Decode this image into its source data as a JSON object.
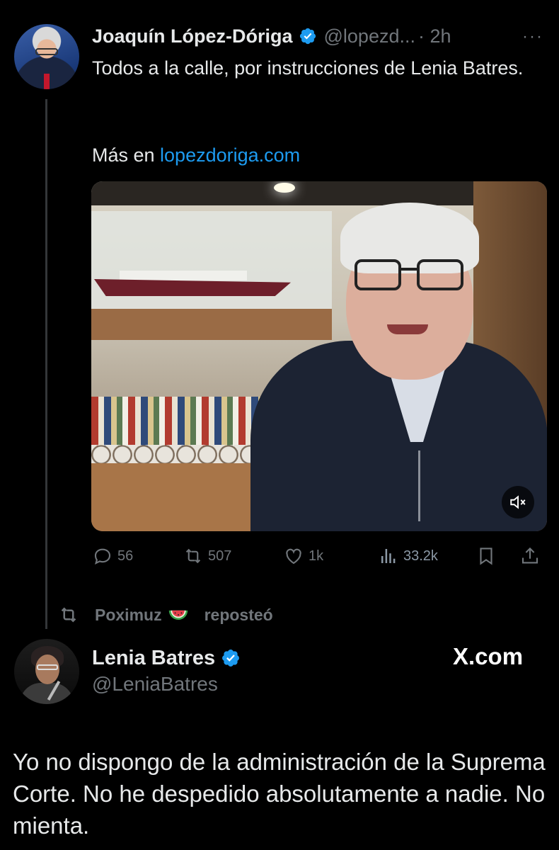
{
  "tweet1": {
    "author_name": "Joaquín López-Dóriga",
    "handle": "@lopezd...",
    "time": "· 2h",
    "more": "···",
    "text": "Todos a la calle, por instrucciones de Lenia Batres.",
    "more_text": "Más en ",
    "link_text": "lopezdoriga.com",
    "actions": {
      "replies": "56",
      "reposts": "507",
      "likes": "1k",
      "views": "33.2k"
    }
  },
  "repost": {
    "user": "Poximuz",
    "label": "reposteó"
  },
  "tweet2": {
    "author_name": "Lenia Batres",
    "handle": "@LeniaBatres",
    "brand": "X.com",
    "text": "Yo no dispongo de la administración de la Suprema Corte. No he despedido absolutamente a nadie. No mienta."
  },
  "colors": {
    "background": "#000000",
    "text": "#e7e9ea",
    "secondary": "#71767b",
    "link": "#1d9bf0",
    "verified": "#1d9bf0"
  },
  "icons": [
    "verified-badge-icon",
    "more-icon",
    "reply-icon",
    "repost-icon",
    "like-icon",
    "views-icon",
    "bookmark-icon",
    "share-icon",
    "mute-icon",
    "watermelon-icon"
  ]
}
